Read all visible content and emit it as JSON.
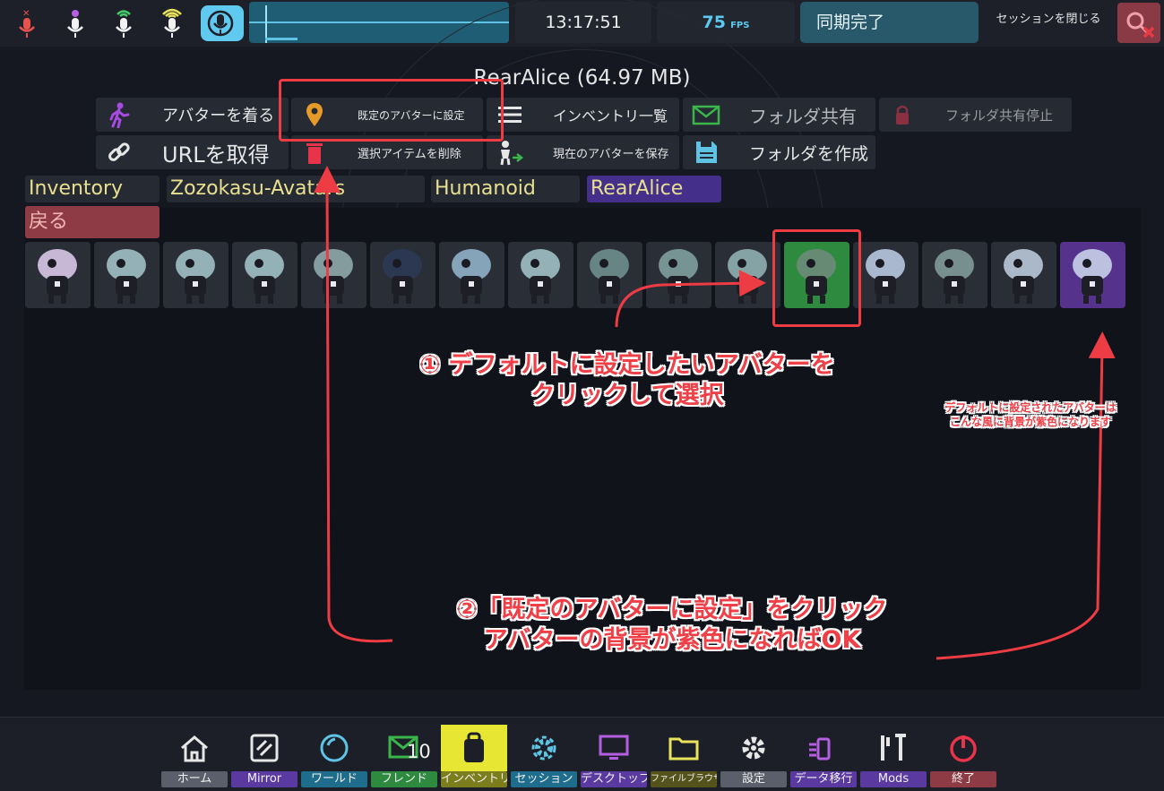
{
  "topbar": {
    "clock": "13:17:51",
    "fps_value": "75",
    "fps_unit": "FPS",
    "sync_status": "同期完了",
    "close_session": "セッションを閉じる"
  },
  "panel": {
    "avatar_title": "RearAlice (64.97 MB)",
    "actions": {
      "wear_avatar": "アバターを着る",
      "set_default": "既定のアバターに設定",
      "inventory_list": "インベントリ一覧",
      "folder_share": "フォルダ共有",
      "stop_folder_share": "フォルダ共有停止",
      "get_url": "URLを取得",
      "delete_selected": "選択アイテムを削除",
      "save_current_avatar": "現在のアバターを保存",
      "create_folder": "フォルダを作成"
    },
    "breadcrumbs": [
      "Inventory",
      "Zozokasu-Avatars",
      "Humanoid",
      "RearAlice"
    ],
    "back": "戻る",
    "thumb_count": 16,
    "selected_index": 11,
    "default_index": 15
  },
  "annotations": {
    "step1_line1": "① デフォルトに設定したいアバターを",
    "step1_line2": "クリックして選択",
    "side_line1": "デフォルトに設定されたアバターは",
    "side_line2": "こんな風に背景が紫色になります",
    "step2_line1": "②「既定のアバターに設定」をクリック",
    "step2_line2": "アバターの背景が紫色になればOK"
  },
  "dock": {
    "items": [
      {
        "label": "ホーム",
        "color": "#5a5f6b"
      },
      {
        "label": "Mirror",
        "color": "#5a3aa0"
      },
      {
        "label": "ワールド",
        "color": "#1f6d8c"
      },
      {
        "label": "フレンド",
        "color": "#2d8a3e",
        "badge": "10"
      },
      {
        "label": "インベントリ",
        "color": "#7c7d1d"
      },
      {
        "label": "セッション",
        "color": "#1f6d8c"
      },
      {
        "label": "デスクトップ",
        "color": "#5a3aa0"
      },
      {
        "label": "ファイルブラウザ",
        "color": "#55531c"
      },
      {
        "label": "設定",
        "color": "#5a5f6b"
      },
      {
        "label": "データ移行",
        "color": "#5a3aa0"
      },
      {
        "label": "Mods",
        "color": "#5a3aa0"
      },
      {
        "label": "終了",
        "color": "#8e3b45"
      }
    ]
  },
  "colors": {
    "accent_cyan": "#5fc9f0",
    "annotation_red": "#ee3c44",
    "selected_green": "#2d8a3e",
    "default_purple": "#55338c"
  }
}
